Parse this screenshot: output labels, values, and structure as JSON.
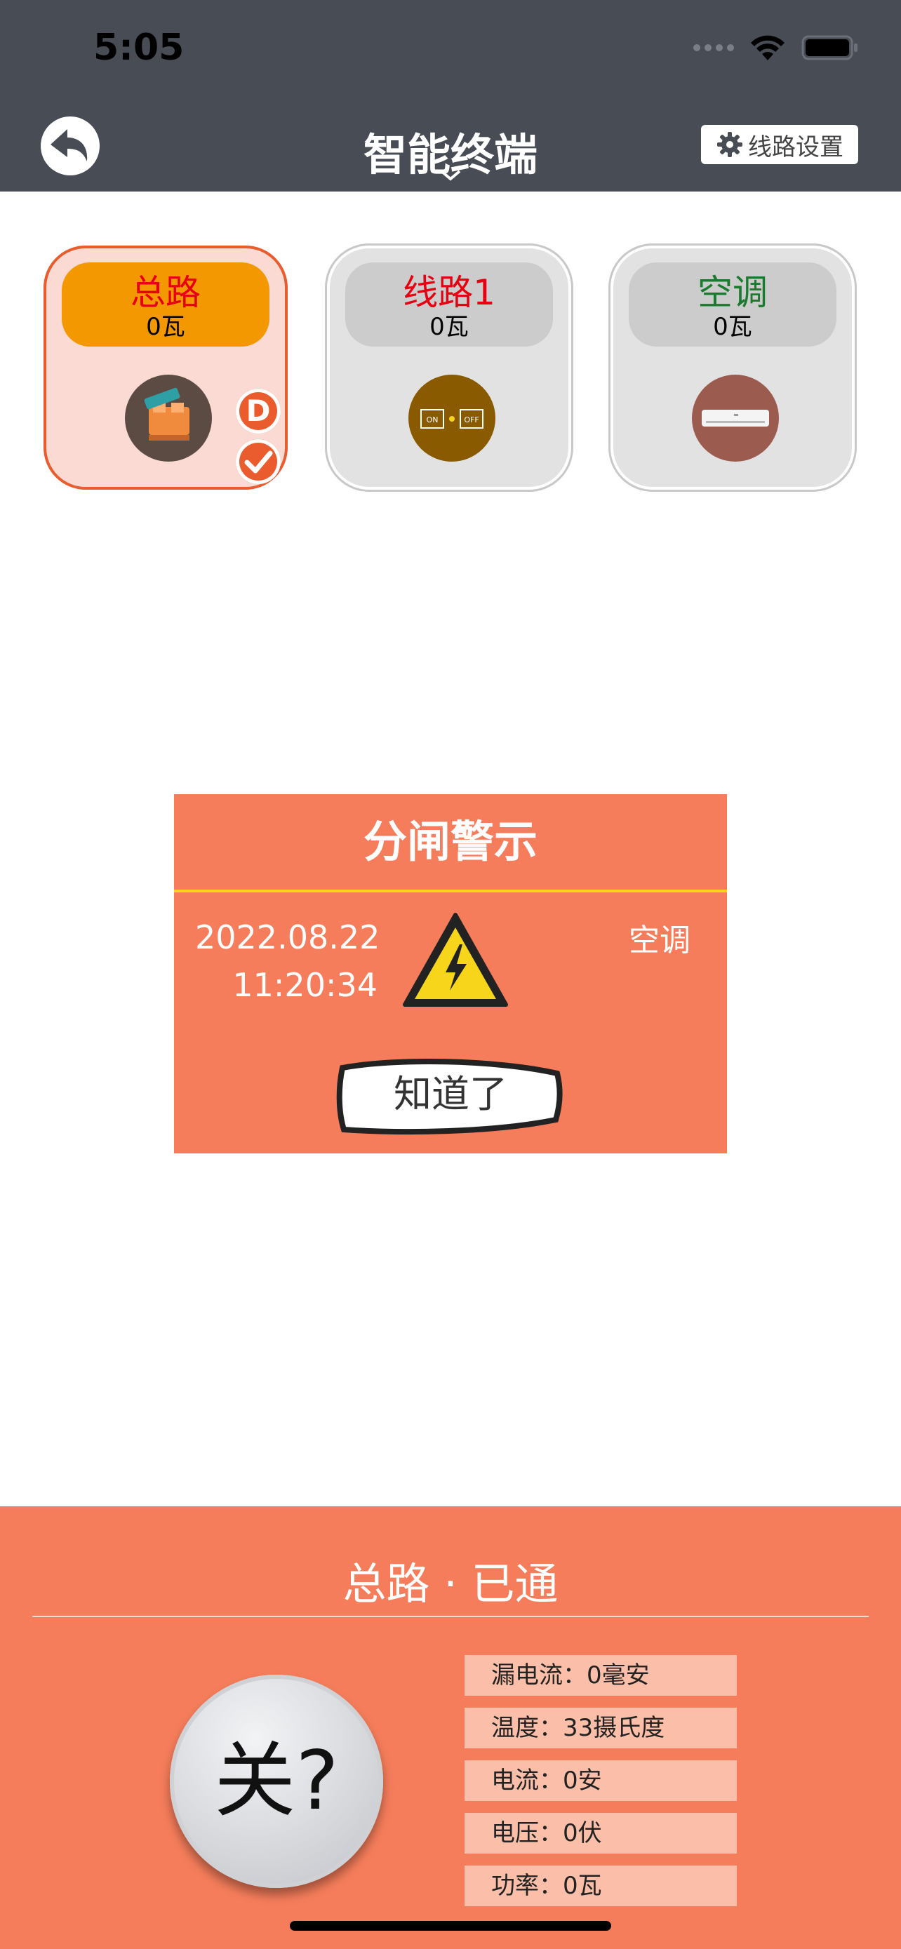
{
  "status_bar": {
    "time": "5:05"
  },
  "nav": {
    "title": "智能终端",
    "settings_label": "线路设置"
  },
  "cards": [
    {
      "name": "总路",
      "power": "0瓦",
      "name_color": "#e60012",
      "icon": "breaker-icon",
      "badge": "D",
      "selected": true
    },
    {
      "name": "线路1",
      "power": "0瓦",
      "name_color": "#e60012",
      "icon": "on-off-switch-icon",
      "selected": false
    },
    {
      "name": "空调",
      "power": "0瓦",
      "name_color": "#1a7a2e",
      "icon": "air-conditioner-icon",
      "selected": false
    }
  ],
  "dialog": {
    "title": "分闸警示",
    "date": "2022.08.22",
    "time": "11:20:34",
    "device": "空调",
    "ok_label": "知道了"
  },
  "panel": {
    "title": "总路 · 已通",
    "power_button_label": "关?",
    "metrics": [
      {
        "label": "漏电流：0毫安"
      },
      {
        "label": "温度：33摄氏度"
      },
      {
        "label": "电流：0安"
      },
      {
        "label": "电压：0伏"
      },
      {
        "label": "功率：0瓦"
      }
    ]
  },
  "colors": {
    "topbar": "#474c55",
    "accent": "#f57d5b",
    "selected_border": "#ea5b2d",
    "selected_pill": "#f39800"
  }
}
